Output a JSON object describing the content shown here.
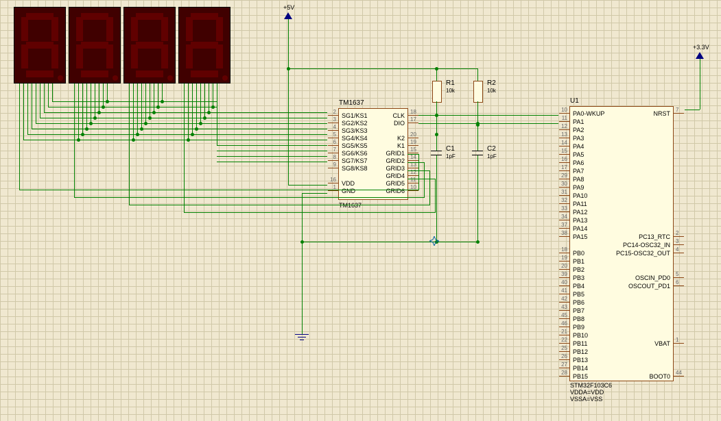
{
  "power": {
    "v5": "+5V",
    "v33": "+3.3V"
  },
  "seven_seg": {
    "count": 4
  },
  "tm1637": {
    "ref": "TM1637",
    "part": "TM1637",
    "left_pins": [
      {
        "num": "2",
        "label": "SG1/KS1"
      },
      {
        "num": "3",
        "label": "SG2/KS2"
      },
      {
        "num": "4",
        "label": "SG3/KS3"
      },
      {
        "num": "5",
        "label": "SG4/KS4"
      },
      {
        "num": "6",
        "label": "SG5/KS5"
      },
      {
        "num": "7",
        "label": "SG6/KS6"
      },
      {
        "num": "8",
        "label": "SG7/KS7"
      },
      {
        "num": "9",
        "label": "SG8/KS8"
      },
      {
        "num": "",
        "label": ""
      },
      {
        "num": "16",
        "label": "VDD"
      },
      {
        "num": "1",
        "label": "GND"
      }
    ],
    "right_pins": [
      {
        "num": "18",
        "label": "CLK"
      },
      {
        "num": "17",
        "label": "DIO"
      },
      {
        "num": "",
        "label": ""
      },
      {
        "num": "20",
        "label": "K2"
      },
      {
        "num": "19",
        "label": "K1"
      },
      {
        "num": "15",
        "label": "GRID1"
      },
      {
        "num": "14",
        "label": "GRID2"
      },
      {
        "num": "13",
        "label": "GRID3"
      },
      {
        "num": "12",
        "label": "GRID4"
      },
      {
        "num": "11",
        "label": "GRID5"
      },
      {
        "num": "10",
        "label": "GRID6"
      }
    ]
  },
  "r1": {
    "ref": "R1",
    "value": "10k"
  },
  "r2": {
    "ref": "R2",
    "value": "10k"
  },
  "c1": {
    "ref": "C1",
    "value": "1pF"
  },
  "c2": {
    "ref": "C2",
    "value": "1pF"
  },
  "u1": {
    "ref": "U1",
    "part": "STM32F103C6",
    "footer2": "VDDA=VDD",
    "footer3": "VSSA=VSS",
    "left_pins": [
      {
        "num": "10",
        "label": "PA0-WKUP"
      },
      {
        "num": "11",
        "label": "PA1"
      },
      {
        "num": "12",
        "label": "PA2"
      },
      {
        "num": "13",
        "label": "PA3"
      },
      {
        "num": "14",
        "label": "PA4"
      },
      {
        "num": "15",
        "label": "PA5"
      },
      {
        "num": "16",
        "label": "PA6"
      },
      {
        "num": "17",
        "label": "PA7"
      },
      {
        "num": "29",
        "label": "PA8"
      },
      {
        "num": "30",
        "label": "PA9"
      },
      {
        "num": "31",
        "label": "PA10"
      },
      {
        "num": "32",
        "label": "PA11"
      },
      {
        "num": "33",
        "label": "PA12"
      },
      {
        "num": "34",
        "label": "PA13"
      },
      {
        "num": "37",
        "label": "PA14"
      },
      {
        "num": "38",
        "label": "PA15"
      },
      {
        "num": "",
        "label": ""
      },
      {
        "num": "18",
        "label": "PB0"
      },
      {
        "num": "19",
        "label": "PB1"
      },
      {
        "num": "20",
        "label": "PB2"
      },
      {
        "num": "39",
        "label": "PB3"
      },
      {
        "num": "40",
        "label": "PB4"
      },
      {
        "num": "41",
        "label": "PB5"
      },
      {
        "num": "42",
        "label": "PB6"
      },
      {
        "num": "43",
        "label": "PB7"
      },
      {
        "num": "45",
        "label": "PB8"
      },
      {
        "num": "46",
        "label": "PB9"
      },
      {
        "num": "21",
        "label": "PB10"
      },
      {
        "num": "22",
        "label": "PB11"
      },
      {
        "num": "25",
        "label": "PB12"
      },
      {
        "num": "26",
        "label": "PB13"
      },
      {
        "num": "27",
        "label": "PB14"
      },
      {
        "num": "28",
        "label": "PB15"
      }
    ],
    "right_pins": [
      {
        "num": "7",
        "label": "NRST"
      },
      {
        "num": "",
        "label": ""
      },
      {
        "num": "",
        "label": ""
      },
      {
        "num": "",
        "label": ""
      },
      {
        "num": "",
        "label": ""
      },
      {
        "num": "",
        "label": ""
      },
      {
        "num": "",
        "label": ""
      },
      {
        "num": "",
        "label": ""
      },
      {
        "num": "",
        "label": ""
      },
      {
        "num": "",
        "label": ""
      },
      {
        "num": "",
        "label": ""
      },
      {
        "num": "",
        "label": ""
      },
      {
        "num": "",
        "label": ""
      },
      {
        "num": "",
        "label": ""
      },
      {
        "num": "",
        "label": ""
      },
      {
        "num": "2",
        "label": "PC13_RTC"
      },
      {
        "num": "3",
        "label": "PC14-OSC32_IN"
      },
      {
        "num": "4",
        "label": "PC15-OSC32_OUT"
      },
      {
        "num": "",
        "label": ""
      },
      {
        "num": "",
        "label": ""
      },
      {
        "num": "5",
        "label": "OSCIN_PD0"
      },
      {
        "num": "6",
        "label": "OSCOUT_PD1"
      },
      {
        "num": "",
        "label": ""
      },
      {
        "num": "",
        "label": ""
      },
      {
        "num": "",
        "label": ""
      },
      {
        "num": "",
        "label": ""
      },
      {
        "num": "",
        "label": ""
      },
      {
        "num": "",
        "label": ""
      },
      {
        "num": "1",
        "label": "VBAT"
      },
      {
        "num": "",
        "label": ""
      },
      {
        "num": "",
        "label": ""
      },
      {
        "num": "",
        "label": ""
      },
      {
        "num": "44",
        "label": "BOOT0"
      }
    ]
  }
}
